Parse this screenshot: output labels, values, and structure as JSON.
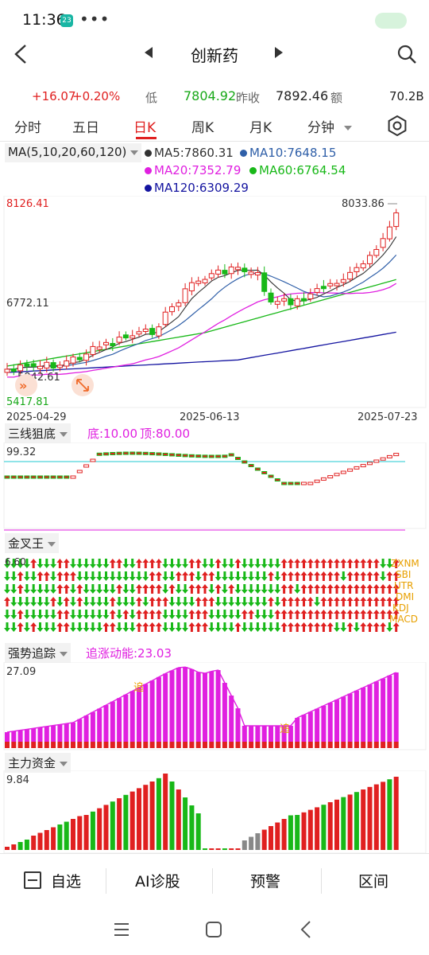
{
  "status_bar": {
    "time": "11:36",
    "badge": "23",
    "dots": "•••"
  },
  "header": {
    "title": "创新药"
  },
  "quote": {
    "change": "+16.07",
    "change_pct": "+0.20%",
    "low_label": "低",
    "low_value": "7804.92",
    "prev_close_label": "昨收",
    "prev_close_value": "7892.46",
    "amount_label": "额",
    "amount_value": "70.2B"
  },
  "tabs": [
    {
      "label": "分时",
      "active": false
    },
    {
      "label": "五日",
      "active": false
    },
    {
      "label": "日K",
      "active": true
    },
    {
      "label": "周K",
      "active": false
    },
    {
      "label": "月K",
      "active": false
    },
    {
      "label": "分钟",
      "active": false
    }
  ],
  "main_chart": {
    "indicator_label": "MA(5,10,20,60,120)",
    "ma": [
      {
        "label": "MA5:7860.31",
        "color": "#333333"
      },
      {
        "label": "MA10:7648.15",
        "color": "#2f5fa8"
      },
      {
        "label": "MA20:7352.79",
        "color": "#e020e0"
      },
      {
        "label": "MA60:6764.54",
        "color": "#18b818"
      },
      {
        "label": "MA120:6309.29",
        "color": "#1414a0"
      }
    ],
    "y_top": "8126.41",
    "y_mid": "6772.11",
    "y_bottom": "5417.81",
    "high_mark": "8033.86",
    "low_mark": "5842.61",
    "dates": [
      "2025-04-29",
      "2025-06-13",
      "2025-07-23"
    ]
  },
  "panel1": {
    "label": "三线狙底",
    "bottom_label": "底:10.00",
    "top_label": "顶:80.00",
    "value": "99.32"
  },
  "panel2": {
    "label": "金叉王",
    "value": "6.60",
    "legend": [
      "ZXNM",
      "SBI",
      "UTR",
      "DMI",
      "KDJ",
      "MACD"
    ]
  },
  "panel3": {
    "label": "强势追踪",
    "sub_label": "追涨动能:23.03",
    "value": "27.09",
    "marker": "追"
  },
  "panel4": {
    "label": "主力资金",
    "value": "9.84"
  },
  "bottom_bar": {
    "watchlist": "自选",
    "ai": "AI诊股",
    "alert": "预警",
    "range": "区间"
  },
  "colors": {
    "up": "#e02020",
    "down": "#18b818",
    "magenta": "#e020e0"
  }
}
